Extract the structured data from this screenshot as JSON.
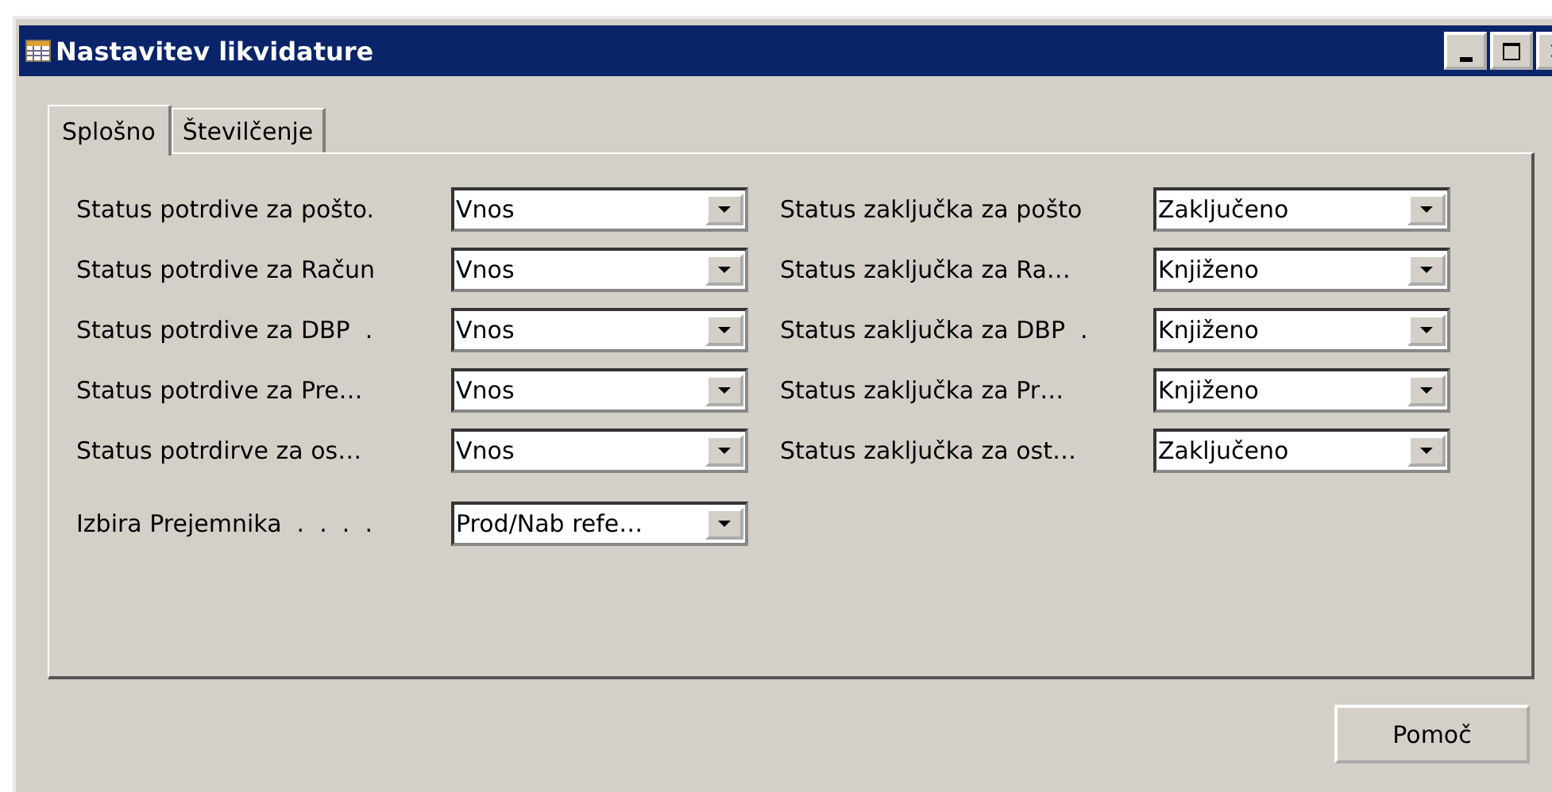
{
  "window": {
    "title": "Nastavitev likvidature"
  },
  "tabs": [
    {
      "label": "Splošno",
      "selected": true
    },
    {
      "label": "Številčenje",
      "selected": false
    }
  ],
  "left_fields": [
    {
      "label": "Status potrdive za pošto.",
      "value": "Vnos"
    },
    {
      "label": "Status potrdive za Račun",
      "value": "Vnos"
    },
    {
      "label": "Status potrdive za DBP  .",
      "value": "Vnos"
    },
    {
      "label": "Status potrdive za Pre…",
      "value": "Vnos"
    },
    {
      "label": "Status potrdirve za os…",
      "value": "Vnos"
    }
  ],
  "extra_field": {
    "label": "Izbira Prejemnika  .  .  .  .",
    "value": "Prod/Nab refe…"
  },
  "right_fields": [
    {
      "label": "Status zaključka za pošto",
      "value": "Zaključeno"
    },
    {
      "label": "Status zaključka za Ra…",
      "value": "Knjiženo"
    },
    {
      "label": "Status zaključka za DBP  .",
      "value": "Knjiženo"
    },
    {
      "label": "Status zaključka za Pr…",
      "value": "Knjiženo"
    },
    {
      "label": "Status zaključka za ost…",
      "value": "Zaključeno"
    }
  ],
  "buttons": [
    "Pomoč"
  ]
}
